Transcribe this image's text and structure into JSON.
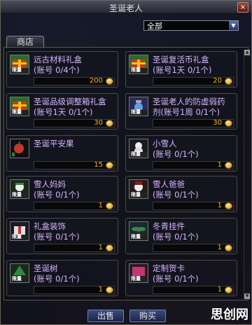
{
  "window": {
    "title": "圣诞老人",
    "close_glyph": "×"
  },
  "filter": {
    "selected": "全部"
  },
  "tabs": [
    {
      "label": "商店"
    }
  ],
  "items": [
    {
      "name": "远古材料礼盒",
      "limit": "(账号 0/4个)",
      "price": "200",
      "icon": "gift-icon",
      "icon_badge": "限量"
    },
    {
      "name": "圣诞复活币礼盒",
      "limit": "(账号1天 0/1个)",
      "price": "20",
      "icon": "gift-icon",
      "icon_badge": "限量"
    },
    {
      "name": "圣诞品级调整箱礼盒",
      "limit": "(账号1天 0/1个)",
      "price": "30",
      "icon": "gift-icon",
      "icon_badge": "限量"
    },
    {
      "name": "圣诞老人的防虚弱药",
      "limit": "剂(账号1周 0/1个)",
      "price": "30",
      "icon": "potion-icon",
      "icon_badge": "限量"
    },
    {
      "name": "圣诞平安果",
      "limit": "",
      "price": "15",
      "icon": "apple-icon",
      "icon_badge": "E"
    },
    {
      "name": "小雪人",
      "limit": "(账号 0/1个)",
      "price": "1",
      "icon": "snowman-icon",
      "icon_badge": "限量"
    },
    {
      "name": "雪人妈妈",
      "limit": "(账号 0/1个)",
      "price": "1",
      "icon": "snowman-mom-icon",
      "icon_badge": "限量"
    },
    {
      "name": "雪人爸爸",
      "limit": "(账号 0/1个)",
      "price": "1",
      "icon": "snowman-dad-icon",
      "icon_badge": "限量"
    },
    {
      "name": "礼盒装饰",
      "limit": "(账号 0/1个)",
      "price": "1",
      "icon": "gift-decor-icon",
      "icon_badge": "限量"
    },
    {
      "name": "冬青挂件",
      "limit": "(账号 0/1个)",
      "price": "1",
      "icon": "holly-icon",
      "icon_badge": "限量"
    },
    {
      "name": "圣诞树",
      "limit": "(账号 0/1个)",
      "price": "1",
      "icon": "tree-icon",
      "icon_badge": "限量"
    },
    {
      "name": "定制贺卡",
      "limit": "(账号 0/1个)",
      "price": "1",
      "icon": "card-icon",
      "icon_badge": "限量"
    }
  ],
  "buttons": {
    "sell": "出售",
    "buy": "购买"
  },
  "watermark": "思创网",
  "colors": {
    "item_text": "#d8b3ff",
    "price": "#f4b400",
    "accent_btn": "#2a3a6a"
  }
}
